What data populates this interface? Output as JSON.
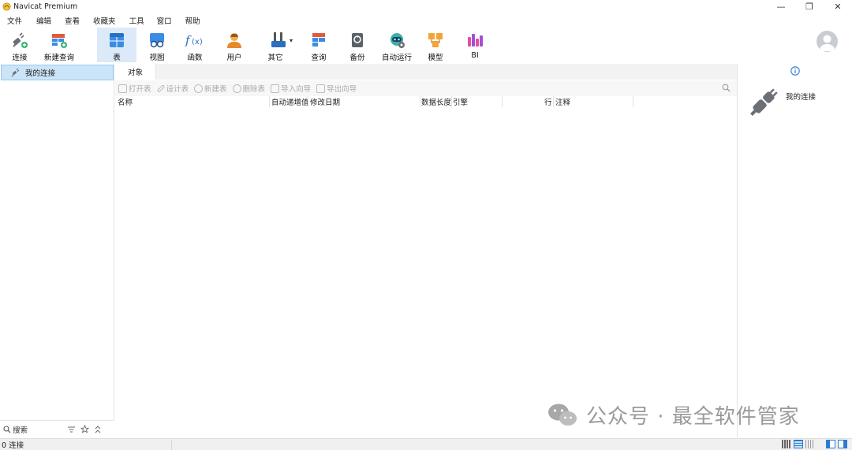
{
  "window": {
    "title": "Navicat Premium",
    "minimize_glyph": "—",
    "restore_glyph": "❐",
    "close_glyph": "✕"
  },
  "menu": [
    "文件",
    "编辑",
    "查看",
    "收藏夹",
    "工具",
    "窗口",
    "帮助"
  ],
  "toolbar": {
    "items": [
      {
        "label": "连接",
        "icon": "plug-icon"
      },
      {
        "label": "新建查询",
        "icon": "new-query-icon"
      },
      {
        "label": "表",
        "icon": "table-icon",
        "active": true
      },
      {
        "label": "视图",
        "icon": "view-icon"
      },
      {
        "label": "函数",
        "icon": "function-icon"
      },
      {
        "label": "用户",
        "icon": "user-icon"
      },
      {
        "label": "其它",
        "icon": "tools-icon"
      },
      {
        "label": "查询",
        "icon": "query-icon"
      },
      {
        "label": "备份",
        "icon": "backup-icon"
      },
      {
        "label": "自动运行",
        "icon": "robot-icon"
      },
      {
        "label": "模型",
        "icon": "model-icon"
      },
      {
        "label": "BI",
        "icon": "bi-icon"
      }
    ],
    "other_dropdown_glyph": "▾"
  },
  "left_panel": {
    "connection_label": "我的连接",
    "search_label": "搜索"
  },
  "center": {
    "tab_label": "对象",
    "actions": [
      "打开表",
      "设计表",
      "新建表",
      "删除表",
      "导入向导",
      "导出向导"
    ],
    "columns": [
      "名称",
      "自动递增值",
      "修改日期",
      "数据长度",
      "引擎",
      "行",
      "注释"
    ]
  },
  "right_panel": {
    "title": "我的连接"
  },
  "watermark": "公众号 · 最全软件管家",
  "status": {
    "text": "0 连接"
  },
  "colors": {
    "active_tab_bg": "#dbe9f8",
    "selected_item_bg": "#cce4f7",
    "accent": "#2b7cd3"
  }
}
